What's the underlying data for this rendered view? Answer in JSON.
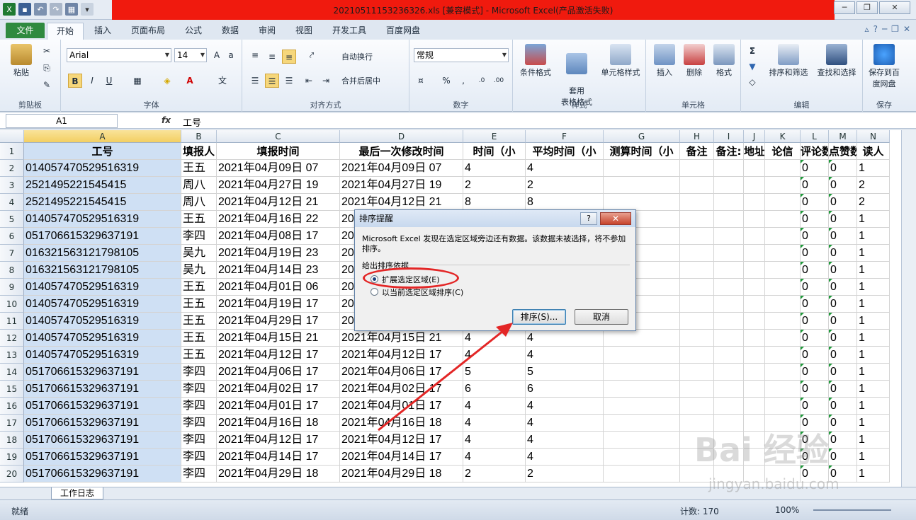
{
  "window": {
    "title": "20210511153236326.xls  [兼容模式]  -  Microsoft Excel(产品激活失败)",
    "accent": "#f01a0e"
  },
  "tabs": [
    "文件",
    "开始",
    "插入",
    "页面布局",
    "公式",
    "数据",
    "审阅",
    "视图",
    "开发工具",
    "百度网盘"
  ],
  "ribbon": {
    "clipboard": {
      "paste": "粘贴",
      "label": "剪贴板"
    },
    "font": {
      "name": "Arial",
      "size": "14",
      "bold": "B",
      "italic": "I",
      "underline": "U",
      "label": "字体"
    },
    "alignment": {
      "wrap": "自动换行",
      "merge": "合并后居中",
      "label": "对齐方式"
    },
    "number": {
      "format": "常规",
      "label": "数字",
      "percent": "%",
      "comma": ","
    },
    "styles": {
      "conditional": "条件格式",
      "table": "套用\n表格格式",
      "cell": "单元格样式",
      "label": "样式"
    },
    "cells": {
      "insert": "插入",
      "delete": "删除",
      "format": "格式",
      "label": "单元格"
    },
    "editing": {
      "sort": "排序和筛选",
      "find": "查找和选择",
      "label": "编辑"
    },
    "save": {
      "button": "保存到百度网盘",
      "label": "保存"
    }
  },
  "formula_bar": {
    "name_box": "A1",
    "fx": "fx",
    "value": "工号"
  },
  "columns": [
    "A",
    "B",
    "C",
    "D",
    "E",
    "F",
    "G",
    "H",
    "I",
    "J",
    "K",
    "L",
    "M",
    "N"
  ],
  "header_row": [
    "工号",
    "填报人",
    "填报时间",
    "最后一次修改时间",
    "时间（小",
    "平均时间（小",
    "测算时间（小",
    "备注",
    "备注:",
    "地址",
    "论信",
    "评论数",
    "点赞数",
    "读人"
  ],
  "rows": [
    {
      "n": "2",
      "a": "01405747052951631​9",
      "b": "王五",
      "c": "2021年04月09日 07",
      "d": "2021年04月09日 07",
      "e": "4",
      "f": "4",
      "l": "0",
      "m": "0",
      "nn": "1"
    },
    {
      "n": "3",
      "a": "2521495221545415",
      "b": "周八",
      "c": "2021年04月27日 19",
      "d": "2021年04月27日 19",
      "e": "2",
      "f": "2",
      "l": "0",
      "m": "0",
      "nn": "2"
    },
    {
      "n": "4",
      "a": "2521495221545415",
      "b": "周八",
      "c": "2021年04月12日 21",
      "d": "2021年04月12日 21",
      "e": "8",
      "f": "8",
      "l": "0",
      "m": "0",
      "nn": "2"
    },
    {
      "n": "5",
      "a": "014057470529516319",
      "b": "王五",
      "c": "2021年04月16日 22",
      "d": "20",
      "e": "",
      "f": "",
      "l": "0",
      "m": "0",
      "nn": "1"
    },
    {
      "n": "6",
      "a": "051706615329637191",
      "b": "李四",
      "c": "2021年04月08日 17",
      "d": "20",
      "e": "",
      "f": "",
      "l": "0",
      "m": "0",
      "nn": "1"
    },
    {
      "n": "7",
      "a": "016321563121798105",
      "b": "吴九",
      "c": "2021年04月19日 23",
      "d": "20",
      "e": "",
      "f": "",
      "l": "0",
      "m": "0",
      "nn": "1"
    },
    {
      "n": "8",
      "a": "016321563121798105",
      "b": "吴九",
      "c": "2021年04月14日 23",
      "d": "20",
      "e": "",
      "f": "",
      "l": "0",
      "m": "0",
      "nn": "1"
    },
    {
      "n": "9",
      "a": "014057470529516319",
      "b": "王五",
      "c": "2021年04月01日 06",
      "d": "20",
      "e": "",
      "f": "",
      "l": "0",
      "m": "0",
      "nn": "1"
    },
    {
      "n": "10",
      "a": "014057470529516319",
      "b": "王五",
      "c": "2021年04月19日 17",
      "d": "20",
      "e": "",
      "f": "",
      "l": "0",
      "m": "0",
      "nn": "1"
    },
    {
      "n": "11",
      "a": "014057470529516319",
      "b": "王五",
      "c": "2021年04月29日 17",
      "d": "20",
      "e": "",
      "f": "",
      "l": "0",
      "m": "0",
      "nn": "1"
    },
    {
      "n": "12",
      "a": "014057470529516319",
      "b": "王五",
      "c": "2021年04月15日 21",
      "d": "2021年04月15日 21",
      "e": "4",
      "f": "4",
      "l": "0",
      "m": "0",
      "nn": "1"
    },
    {
      "n": "13",
      "a": "014057470529516319",
      "b": "王五",
      "c": "2021年04月12日 17",
      "d": "2021年04月12日 17",
      "e": "4",
      "f": "4",
      "l": "0",
      "m": "0",
      "nn": "1"
    },
    {
      "n": "14",
      "a": "051706615329637191",
      "b": "李四",
      "c": "2021年04月06日 17",
      "d": "2021年04月06日 17",
      "e": "5",
      "f": "5",
      "l": "0",
      "m": "0",
      "nn": "1"
    },
    {
      "n": "15",
      "a": "051706615329637191",
      "b": "李四",
      "c": "2021年04月02日 17",
      "d": "2021年04月02日 17",
      "e": "6",
      "f": "6",
      "l": "0",
      "m": "0",
      "nn": "1"
    },
    {
      "n": "16",
      "a": "051706615329637191",
      "b": "李四",
      "c": "2021年04月01日 17",
      "d": "2021年04月01日 17",
      "e": "4",
      "f": "4",
      "l": "0",
      "m": "0",
      "nn": "1"
    },
    {
      "n": "17",
      "a": "051706615329637191",
      "b": "李四",
      "c": "2021年04月16日 18",
      "d": "2021年04月16日 18",
      "e": "4",
      "f": "4",
      "l": "0",
      "m": "0",
      "nn": "1"
    },
    {
      "n": "18",
      "a": "051706615329637191",
      "b": "李四",
      "c": "2021年04月12日 17",
      "d": "2021年04月12日 17",
      "e": "4",
      "f": "4",
      "l": "0",
      "m": "0",
      "nn": "1"
    },
    {
      "n": "19",
      "a": "051706615329637191",
      "b": "李四",
      "c": "2021年04月14日 17",
      "d": "2021年04月14日 17",
      "e": "4",
      "f": "4",
      "l": "0",
      "m": "0",
      "nn": "1"
    },
    {
      "n": "20",
      "a": "051706615329637191",
      "b": "李四",
      "c": "2021年04月29日 18",
      "d": "2021年04月29日 18",
      "e": "2",
      "f": "2",
      "l": "0",
      "m": "0",
      "nn": "1"
    }
  ],
  "sheet_tab": "工作日志",
  "status": {
    "ready": "就绪",
    "count": "计数: 170",
    "zoom": "100%"
  },
  "dialog": {
    "title": "排序提醒",
    "help": "?",
    "close": "✕",
    "message": "Microsoft Excel 发现在选定区域旁边还有数据。该数据未被选择，将不参加排序。",
    "section": "给出排序依据",
    "option1": "扩展选定区域(E)",
    "option2": "以当前选定区域排序(C)",
    "sort_button": "排序(S)...",
    "cancel_button": "取消"
  },
  "watermark": {
    "logo": "Bai 经验",
    "url": "jingyan.baidu.com"
  }
}
